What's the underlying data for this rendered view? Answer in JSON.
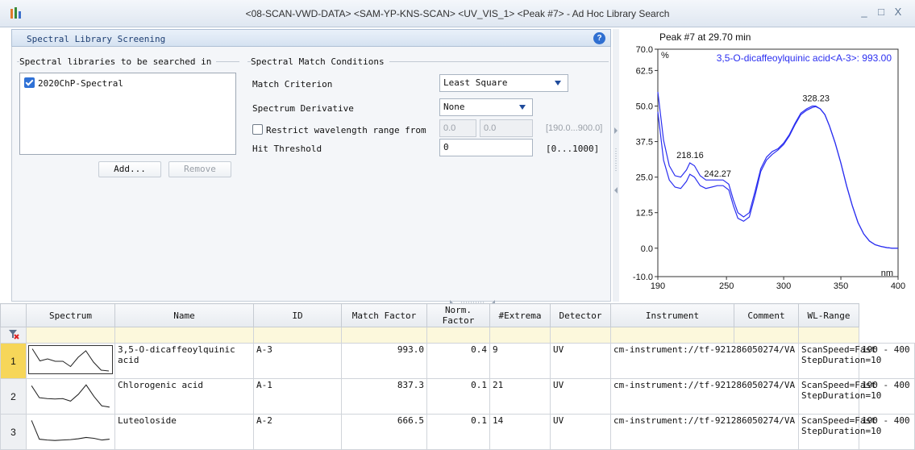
{
  "window": {
    "title": "<08-SCAN-VWD-DATA> <SAM-YP-KNS-SCAN> <UV_VIS_1> <Peak #7> - Ad Hoc Library Search",
    "controls": [
      "_",
      "□",
      "X"
    ]
  },
  "screening": {
    "title": "Spectral Library Screening",
    "help_label": "?",
    "libraries_legend": "Spectral libraries to be searched in",
    "libraries": [
      {
        "name": "2020ChP-Spectral",
        "checked": true
      }
    ],
    "add_label": "Add...",
    "remove_label": "Remove",
    "conditions_legend": "Spectral Match Conditions",
    "match_criterion_label": "Match Criterion",
    "match_criterion_value": "Least Square",
    "derivative_label": "Spectrum Derivative",
    "derivative_value": "None",
    "restrict_label": "Restrict wavelength range from",
    "restrict_checked": false,
    "range_from": "0.0",
    "range_to": "0.0",
    "range_hint": "[190.0...900.0]",
    "threshold_label": "Hit Threshold",
    "threshold_value": "0",
    "threshold_hint": "[0...1000]"
  },
  "chart_data": {
    "type": "line",
    "title": "Peak #7 at 29.70 min",
    "annotation": "3,5-O-dicaffeoylquinic acid<A-3>: 993.00",
    "xlabel": "nm",
    "ylabel": "%",
    "xlim": [
      190,
      400
    ],
    "ylim": [
      -10,
      70
    ],
    "xticks": [
      190,
      250,
      300,
      350,
      400
    ],
    "yticks": [
      -10.0,
      0.0,
      12.5,
      25.0,
      37.5,
      50.0,
      62.5,
      70.0
    ],
    "ytick_labels": [
      "-10.0",
      "0.0",
      "12.5",
      "25.0",
      "37.5",
      "50.0",
      "62.5",
      "70.0"
    ],
    "peak_labels": [
      {
        "x": 218.16,
        "y": 30.0,
        "text": "218.16"
      },
      {
        "x": 242.27,
        "y": 23.5,
        "text": "242.27"
      },
      {
        "x": 328.23,
        "y": 50.0,
        "text": "328.23"
      }
    ],
    "series": [
      {
        "x": [
          190,
          195,
          200,
          205,
          210,
          215,
          218,
          222,
          227,
          232,
          237,
          242,
          247,
          252,
          256,
          260,
          265,
          270,
          275,
          280,
          285,
          290,
          295,
          300,
          305,
          310,
          315,
          320,
          325,
          328,
          332,
          336,
          340,
          345,
          350,
          355,
          360,
          365,
          370,
          375,
          380,
          385,
          390,
          395,
          400
        ],
        "values": [
          55,
          38,
          29,
          25.5,
          25,
          27.5,
          30,
          29,
          25.5,
          24,
          24,
          24,
          24,
          22.5,
          17,
          12.5,
          11,
          12.5,
          20,
          28,
          32,
          34,
          35,
          37,
          40,
          44,
          47.5,
          49,
          50,
          50,
          49,
          47,
          43,
          37,
          30,
          22,
          15,
          9,
          5,
          2.5,
          1.2,
          0.6,
          0.2,
          0,
          0
        ]
      },
      {
        "x": [
          190,
          195,
          200,
          205,
          210,
          215,
          218,
          222,
          227,
          232,
          237,
          242,
          247,
          252,
          256,
          260,
          265,
          270,
          275,
          280,
          285,
          290,
          295,
          300,
          305,
          310,
          315,
          320,
          325,
          328,
          332,
          336,
          340,
          345,
          350,
          355,
          360,
          365,
          370,
          375,
          380,
          385,
          390,
          395,
          400
        ],
        "values": [
          48,
          31,
          24,
          21.5,
          21,
          23.5,
          26,
          25,
          22,
          21,
          21.5,
          22,
          22,
          20.5,
          15,
          10.5,
          9.5,
          11,
          18.5,
          27,
          31,
          33,
          34.5,
          36.5,
          39.5,
          43.5,
          47,
          48.5,
          49.5,
          49.8,
          49,
          47,
          43,
          37,
          30,
          22,
          15,
          9,
          5,
          2.5,
          1.2,
          0.6,
          0.2,
          0,
          0
        ]
      }
    ],
    "line_color": "#2b2ff0",
    "grid": false
  },
  "table": {
    "columns": [
      "Spectrum",
      "Name",
      "ID",
      "Match Factor",
      "Norm. Factor",
      "#Extrema",
      "Detector",
      "Instrument",
      "Comment",
      "WL-Range"
    ],
    "rows": [
      {
        "num": "1",
        "name": "3,5-O-dicaffeoylquinic acid",
        "id": "A-3",
        "match": "993.0",
        "norm": "0.4",
        "extrema": "9",
        "detector": "UV",
        "instrument": "cm-instrument://tf-921286050274/VA",
        "comment": "ScanSpeed=Fast StepDuration=10",
        "wl": "190 - 400",
        "thumb": [
          55,
          25,
          30,
          24,
          24,
          11,
          34,
          50,
          22,
          2,
          0
        ]
      },
      {
        "num": "2",
        "name": "Chlorogenic acid",
        "id": "A-1",
        "match": "837.3",
        "norm": "0.1",
        "extrema": "21",
        "detector": "UV",
        "instrument": "cm-instrument://tf-921286050274/VA",
        "comment": "ScanSpeed=Fast StepDuration=10",
        "wl": "190 - 400",
        "thumb": [
          50,
          22,
          20,
          19,
          20,
          14,
          30,
          52,
          25,
          3,
          0
        ]
      },
      {
        "num": "3",
        "name": "Luteoloside",
        "id": "A-2",
        "match": "666.5",
        "norm": "0.1",
        "extrema": "14",
        "detector": "UV",
        "instrument": "cm-instrument://tf-921286050274/VA",
        "comment": "ScanSpeed=Fast StepDuration=10",
        "wl": "190 - 400",
        "thumb": [
          52,
          8,
          6,
          5,
          6,
          7,
          9,
          12,
          10,
          6,
          8
        ]
      }
    ]
  },
  "colors": {
    "accent": "#2f6fd1",
    "selection": "#f6d659",
    "filter_row": "#fcf8dc",
    "spectrum": "#2b2ff0"
  }
}
